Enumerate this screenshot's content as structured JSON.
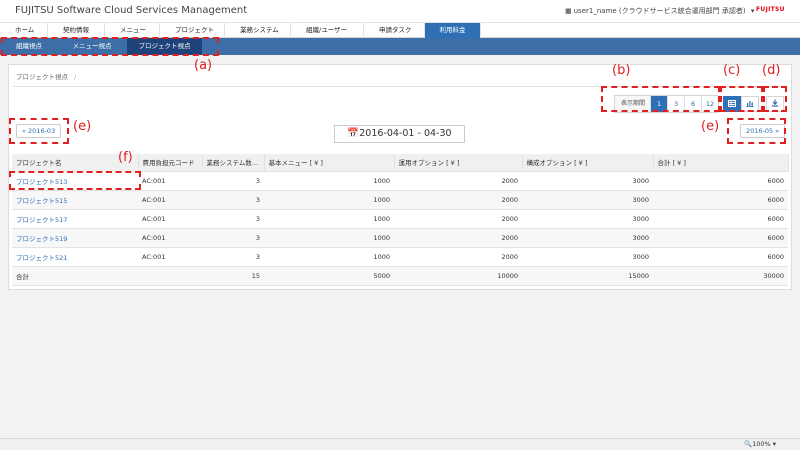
{
  "header": {
    "app_title": "FUJITSU Software Cloud Services Management",
    "user_label": "user1_name (クラウドサービス統合運用部門 承認者)",
    "logo_text": "FUJITSU"
  },
  "main_nav": [
    {
      "label": "ホーム"
    },
    {
      "label": "契約情報"
    },
    {
      "label": "メニュー"
    },
    {
      "label": "プロジェクト"
    },
    {
      "label": "業務システム"
    },
    {
      "label": "組織/ユーザー"
    },
    {
      "label": "申請タスク"
    },
    {
      "label": "利用料金"
    }
  ],
  "sub_nav": [
    {
      "label": "組織視点"
    },
    {
      "label": "メニュー視点"
    },
    {
      "label": "プロジェクト視点"
    }
  ],
  "breadcrumb": {
    "current": "プロジェクト視点",
    "sep": "/"
  },
  "period": {
    "label": "表示期間",
    "options": [
      "1",
      "3",
      "6",
      "12"
    ],
    "selected": "1"
  },
  "view_icons": {
    "table": "table-view-icon",
    "chart": "chart-view-icon",
    "download": "download-icon"
  },
  "nav": {
    "prev": "« 2016-03",
    "next": "2016-05 »",
    "range": "2016-04-01 - 04-30"
  },
  "table": {
    "columns": [
      "プロジェクト名",
      "費用負担元コード",
      "業務システム数…",
      "基本メニュー [ ¥ ]",
      "運用オプション [ ¥ ]",
      "構成オプション [ ¥ ]",
      "合計 [ ¥ ]"
    ],
    "rows": [
      {
        "name": "プロジェクト513",
        "code": "AC:001",
        "systems": "3",
        "base": "1000",
        "ops": "2000",
        "config": "3000",
        "total": "6000"
      },
      {
        "name": "プロジェクト515",
        "code": "AC:001",
        "systems": "3",
        "base": "1000",
        "ops": "2000",
        "config": "3000",
        "total": "6000"
      },
      {
        "name": "プロジェクト517",
        "code": "AC:001",
        "systems": "3",
        "base": "1000",
        "ops": "2000",
        "config": "3000",
        "total": "6000"
      },
      {
        "name": "プロジェクト519",
        "code": "AC:001",
        "systems": "3",
        "base": "1000",
        "ops": "2000",
        "config": "3000",
        "total": "6000"
      },
      {
        "name": "プロジェクト521",
        "code": "AC:001",
        "systems": "3",
        "base": "1000",
        "ops": "2000",
        "config": "3000",
        "total": "6000"
      }
    ],
    "total": {
      "label": "合計",
      "systems": "15",
      "base": "5000",
      "ops": "10000",
      "config": "15000",
      "total": "30000"
    }
  },
  "annotations": {
    "a": "(a)",
    "b": "(b)",
    "c": "(c)",
    "d": "(d)",
    "e": "(e)",
    "f": "(f)"
  },
  "status": {
    "zoom": "100%"
  },
  "colors": {
    "accent": "#2e6fb5",
    "subnav": "#3d6ea8",
    "subnav_active": "#20427a",
    "annotation": "#e02020"
  }
}
